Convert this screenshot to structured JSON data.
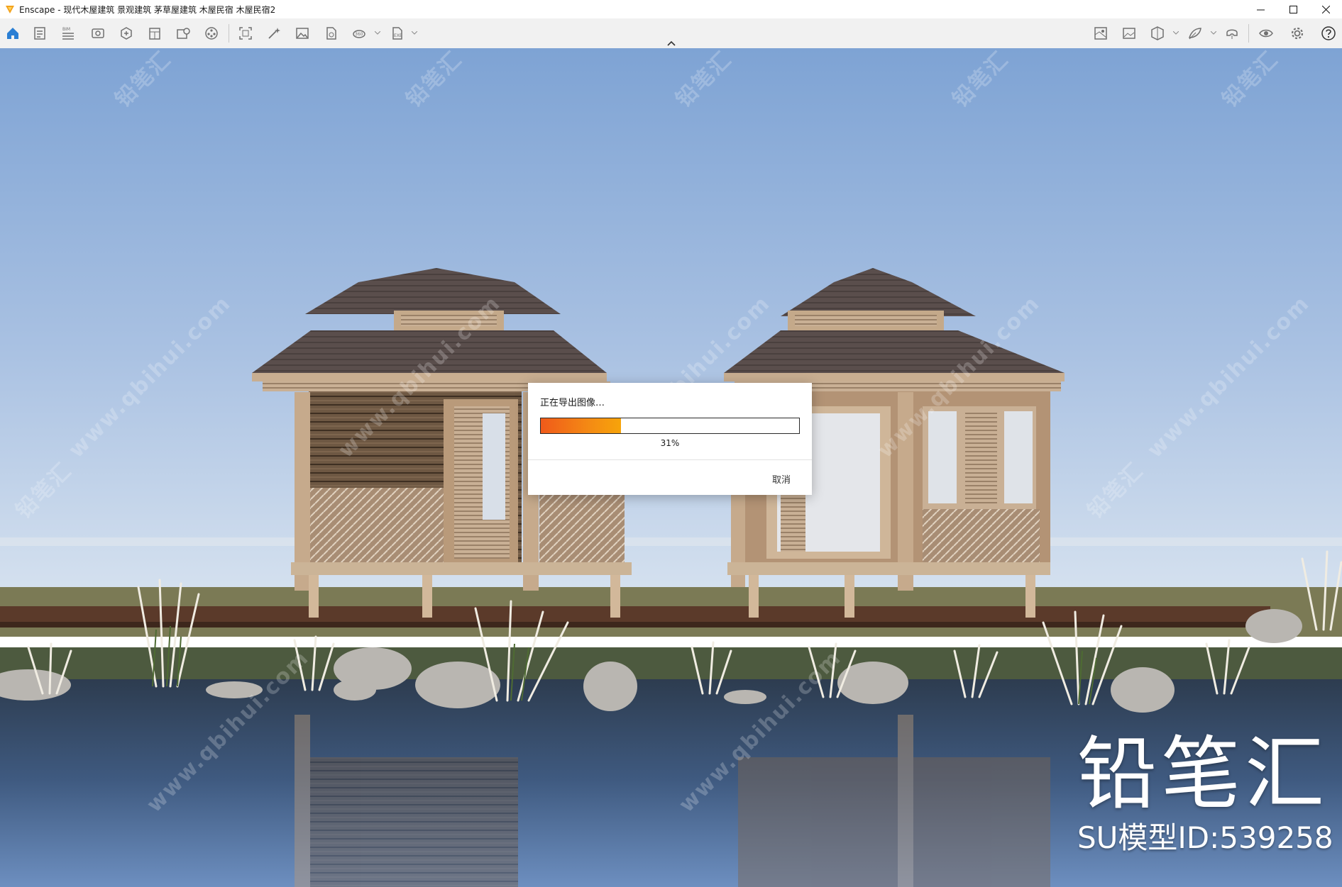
{
  "window": {
    "title": "Enscape - 现代木屋建筑 景观建筑 茅草屋建筑 木屋民宿 木屋民宿2",
    "controls": [
      "minimize-icon",
      "maximize-icon",
      "close-icon"
    ]
  },
  "toolbar": {
    "left_icons": [
      "home-icon",
      "views-panel-icon",
      "bim-info-icon",
      "visual-settings-icon",
      "asset-library-icon",
      "material-editor-icon",
      "site-context-icon",
      "video-editor-icon",
      "screenshot-icon",
      "batch-render-icon",
      "export-image-icon",
      "export-panorama-icon",
      "export-360-icon",
      "export-exe-icon"
    ],
    "bim_label": "BIM",
    "right_icons": [
      "minimap-icon",
      "image-gallery-icon",
      "sectioning-icon",
      "annotation-icon",
      "vr-headset-icon",
      "eye-view-icon",
      "settings-gear-icon",
      "help-icon"
    ]
  },
  "dialog": {
    "title": "正在导出图像…",
    "progress": 0.31,
    "progress_text": "31%",
    "cancel_label": "取消"
  },
  "watermarks": {
    "brand": "铅笔汇",
    "model_id": "SU模型ID:539258",
    "site_text": "www.qbihui.com"
  },
  "colors": {
    "accent_blue": "#2a7fd4",
    "progress_start": "#f05a1a",
    "progress_end": "#f7a40a"
  }
}
